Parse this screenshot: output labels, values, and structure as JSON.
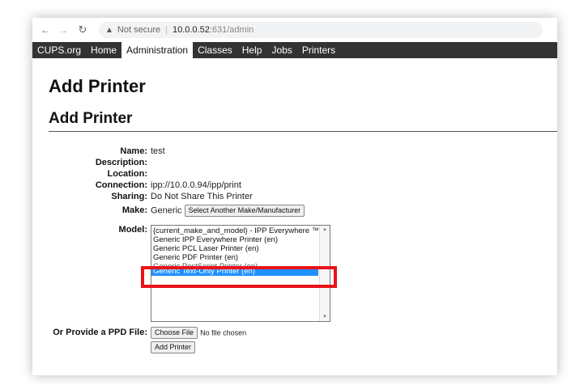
{
  "browser": {
    "back_icon": "back-arrow-icon",
    "forward_icon": "forward-arrow-icon",
    "reload_icon": "reload-icon",
    "security_label": "Not secure",
    "url_host": "10.0.0.52",
    "url_rest": ":631/admin"
  },
  "nav": {
    "tabs": [
      "CUPS.org",
      "Home",
      "Administration",
      "Classes",
      "Help",
      "Jobs",
      "Printers"
    ],
    "active": "Administration"
  },
  "page": {
    "title": "Add Printer",
    "section_title": "Add Printer"
  },
  "form": {
    "name_label": "Name:",
    "name_value": "test",
    "description_label": "Description:",
    "description_value": "",
    "location_label": "Location:",
    "location_value": "",
    "connection_label": "Connection:",
    "connection_value": "ipp://10.0.0.94/ipp/print",
    "sharing_label": "Sharing:",
    "sharing_value": "Do Not Share This Printer",
    "make_label": "Make:",
    "make_value": "Generic",
    "make_button": "Select Another Make/Manufacturer",
    "model_label": "Model:",
    "model_options": [
      "{current_make_and_model} - IPP Everywhere ™",
      "Generic IPP Everywhere Printer (en)",
      "Generic PCL Laser Printer (en)",
      "Generic PDF Printer (en)",
      "Generic PostScript Printer (en)",
      "Generic Text-Only Printer (en)"
    ],
    "model_selected": "Generic Text-Only Printer (en)",
    "ppd_label": "Or Provide a PPD File:",
    "choose_file_button": "Choose File",
    "no_file_text": "No file chosen",
    "add_printer_button": "Add Printer"
  },
  "annotation": {
    "highlight_color": "#e8141a",
    "selected_color": "#1e90ff"
  }
}
